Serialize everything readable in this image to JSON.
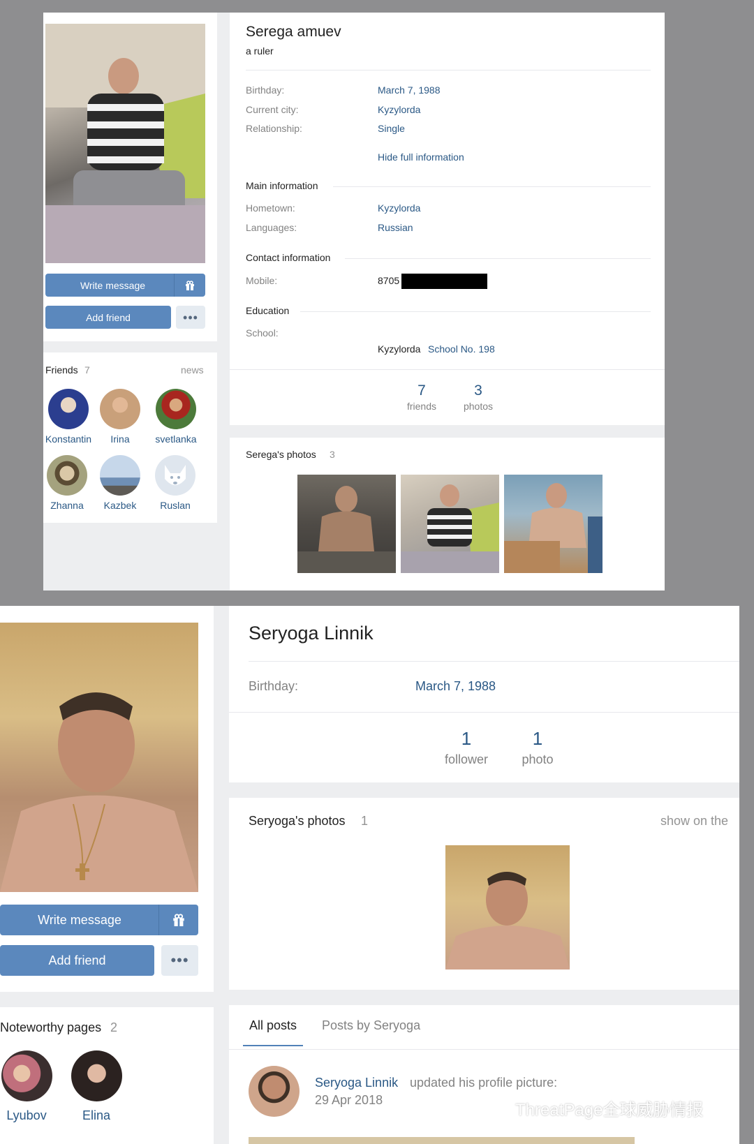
{
  "profile1": {
    "name": "Serega amuev",
    "status": "a ruler",
    "write_message": "Write message",
    "add_friend": "Add friend",
    "info": [
      {
        "label": "Birthday:",
        "value": "March 7, 1988"
      },
      {
        "label": "Current city:",
        "value": "Kyzylorda"
      },
      {
        "label": "Relationship:",
        "value": "Single"
      }
    ],
    "hide_full_info": "Hide full information",
    "main_info": {
      "title": "Main information",
      "rows": [
        {
          "label": "Hometown:",
          "value": "Kyzylorda"
        },
        {
          "label": "Languages:",
          "value": "Russian"
        }
      ]
    },
    "contact": {
      "title": "Contact information",
      "mobile_label": "Mobile:",
      "mobile_value": "8705"
    },
    "education": {
      "title": "Education",
      "school_label": "School:",
      "school_city": "Kyzylorda",
      "school_name": "School No. 198"
    },
    "counts": [
      {
        "number": "7",
        "label": "friends"
      },
      {
        "number": "3",
        "label": "photos"
      }
    ],
    "friends": {
      "title": "Friends",
      "count": "7",
      "news": "news",
      "items": [
        {
          "name": "Konstantin",
          "color": "#2b3e8f"
        },
        {
          "name": "Irina",
          "color": "#c9a07a"
        },
        {
          "name": "svetlanka",
          "color": "#4c7a3a"
        },
        {
          "name": "Zhanna",
          "color": "#a4a27e"
        },
        {
          "name": "Kazbek",
          "color": "#6f8fb5"
        },
        {
          "name": "Ruslan",
          "color": "#dfe6ee"
        }
      ]
    },
    "photos": {
      "title": "Serega's photos",
      "count": "3"
    }
  },
  "profile2": {
    "name": "Seryoga Linnik",
    "birthday_label": "Birthday:",
    "birthday_value": "March 7, 1988",
    "counts": [
      {
        "number": "1",
        "label": "follower"
      },
      {
        "number": "1",
        "label": "photo"
      }
    ],
    "write_message": "Write message",
    "add_friend": "Add friend",
    "photos": {
      "title": "Seryoga's photos",
      "count": "1",
      "show_on": "show on the"
    },
    "noteworthy": {
      "title": "Noteworthy pages",
      "count": "2",
      "items": [
        {
          "name": "Lyubov"
        },
        {
          "name": "Elina"
        }
      ]
    },
    "tabs": [
      "All posts",
      "Posts by Seryoga"
    ],
    "post": {
      "author": "Seryoga Linnik",
      "action": "updated his profile picture:",
      "date": "29 Apr 2018"
    }
  },
  "watermark": "ThreatPage全球威胁情报"
}
